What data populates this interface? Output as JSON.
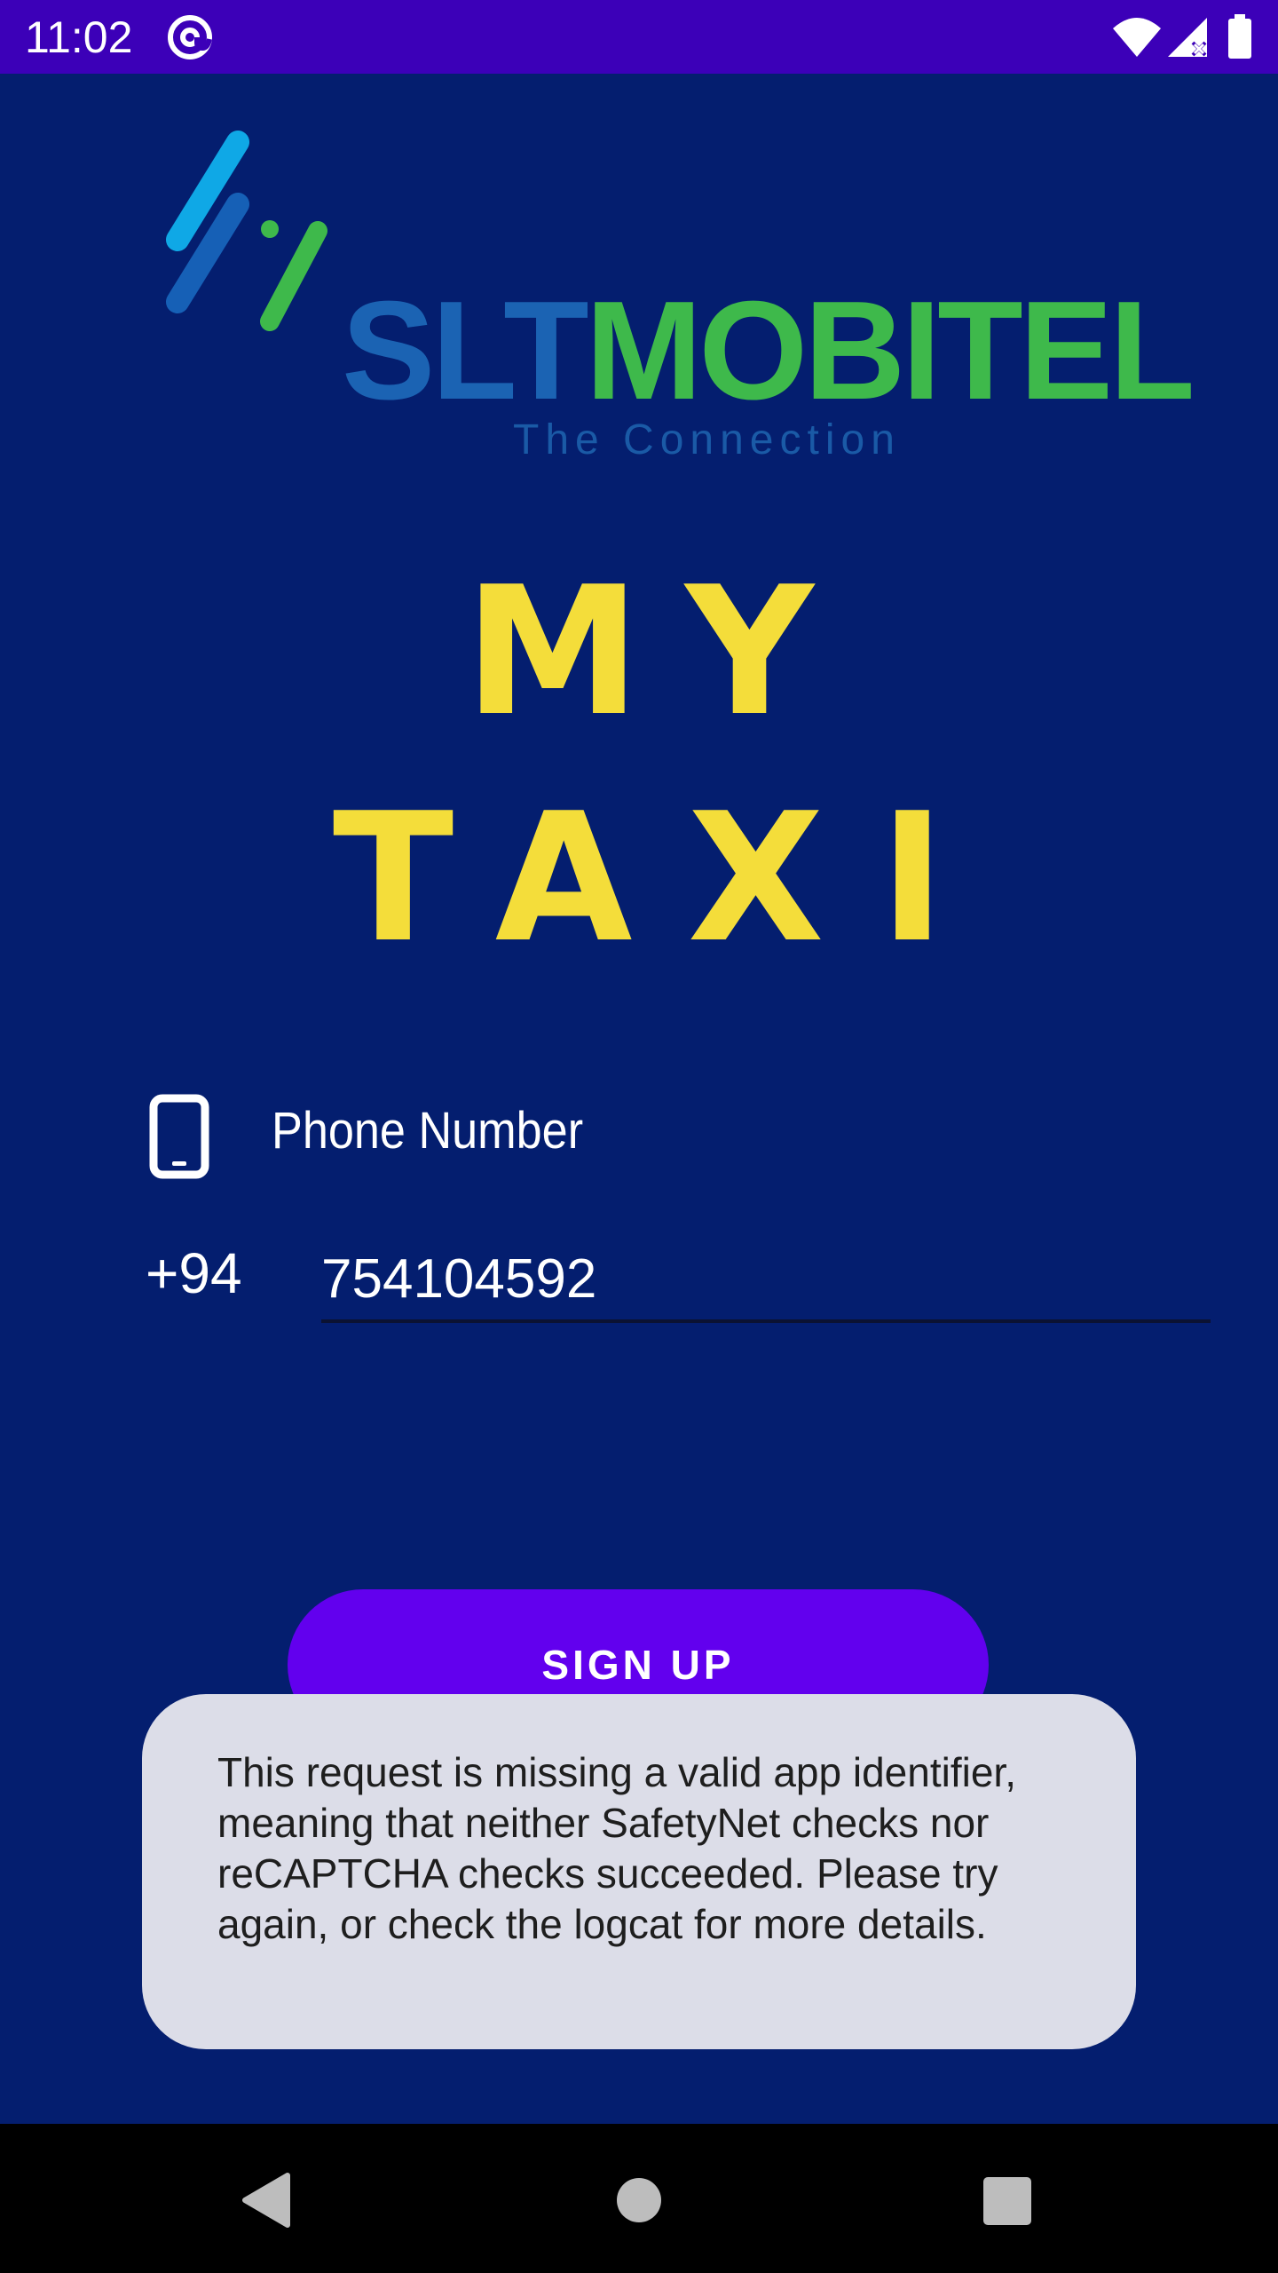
{
  "status_bar": {
    "time": "11:02",
    "icons": [
      "at-sign-icon",
      "wifi-icon",
      "cell-signal-icon",
      "battery-icon"
    ],
    "background_color": "#3c00b8"
  },
  "logo": {
    "word_part_1": "SLT",
    "word_part_2": "MOBITEL",
    "tagline": "The Connection",
    "colors": {
      "slt": "#1b63b3",
      "mobitel": "#3eb94b",
      "stripe_light": "#0fa8e6"
    }
  },
  "title": {
    "line_1": "MY",
    "line_2": "TAXI",
    "color": "#f4dd3a"
  },
  "phone": {
    "label": "Phone Number",
    "icon": "smartphone-icon",
    "country_code": "+94",
    "value": "754104592"
  },
  "signup": {
    "label": "SIGN UP",
    "color": "#6200ee"
  },
  "toast": {
    "message": "This request is missing a valid app identifier, meaning that neither SafetyNet checks nor reCAPTCHA checks succeeded. Please try again, or check the logcat for more details."
  },
  "nav_bar": {
    "icons": [
      "back-icon",
      "home-icon",
      "recents-icon"
    ]
  },
  "theme": {
    "background": "#041e6f"
  }
}
